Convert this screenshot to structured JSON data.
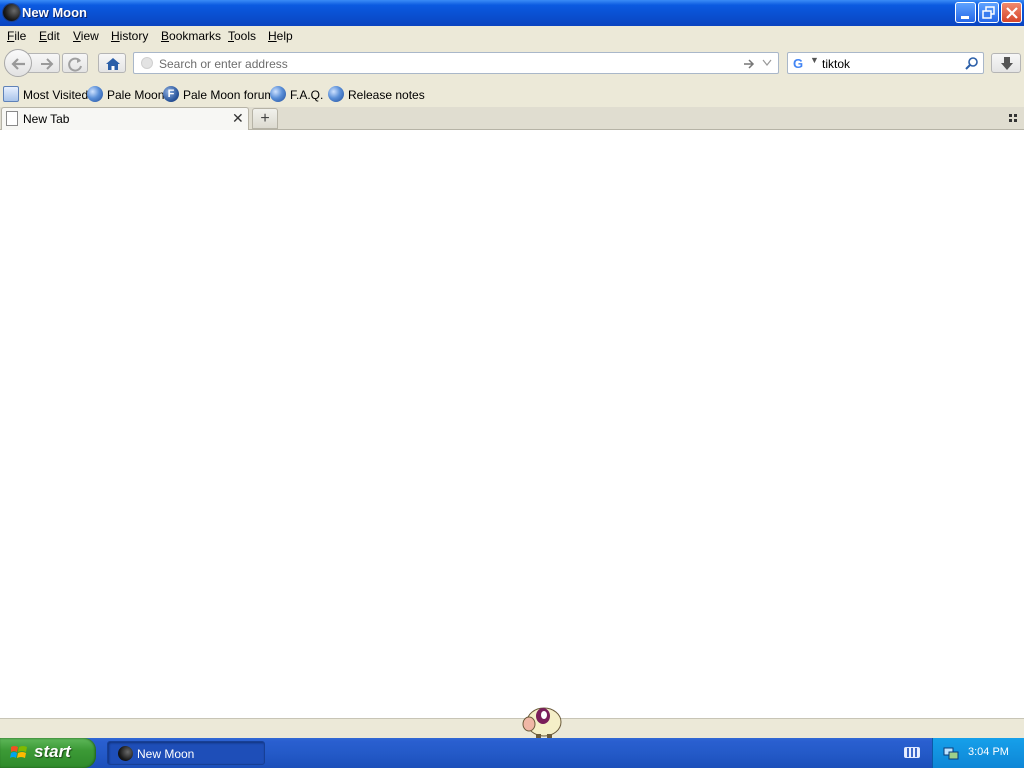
{
  "window": {
    "title": "New Moon"
  },
  "menu": {
    "items": [
      {
        "label": "File",
        "key": "F",
        "rest": "ile"
      },
      {
        "label": "Edit",
        "key": "E",
        "rest": "dit"
      },
      {
        "label": "View",
        "key": "V",
        "rest": "iew"
      },
      {
        "label": "History",
        "key": "H",
        "rest": "istory"
      },
      {
        "label": "Bookmarks",
        "key": "B",
        "rest": "ookmarks"
      },
      {
        "label": "Tools",
        "key": "T",
        "rest": "ools"
      },
      {
        "label": "Help",
        "key": "H",
        "rest": "elp"
      }
    ]
  },
  "navbar": {
    "address_placeholder": "Search or enter address",
    "search_engine": "G",
    "search_query": "tiktok"
  },
  "bookmarks": {
    "items": [
      {
        "label": "Most Visited",
        "icon": "most-visited-icon"
      },
      {
        "label": "Pale Moon",
        "icon": "pale-moon-globe-icon"
      },
      {
        "label": "Pale Moon forum",
        "icon": "forum-icon",
        "glyph": "F"
      },
      {
        "label": "F.A.Q.",
        "icon": "pale-moon-globe-icon"
      },
      {
        "label": "Release notes",
        "icon": "pale-moon-globe-icon"
      }
    ]
  },
  "tabs": {
    "items": [
      {
        "label": "New Tab",
        "active": true
      }
    ],
    "close_glyph": "✕",
    "new_tab_glyph": "+"
  },
  "taskbar": {
    "start_label": "start",
    "task_items": [
      {
        "label": "New Moon"
      }
    ],
    "clock": "3:04 PM"
  },
  "colors": {
    "titlebar": "#0b5ae0",
    "chrome": "#ece9d8",
    "taskbar": "#245ac8",
    "start_button": "#3c9a36",
    "tray": "#0e86d6"
  }
}
